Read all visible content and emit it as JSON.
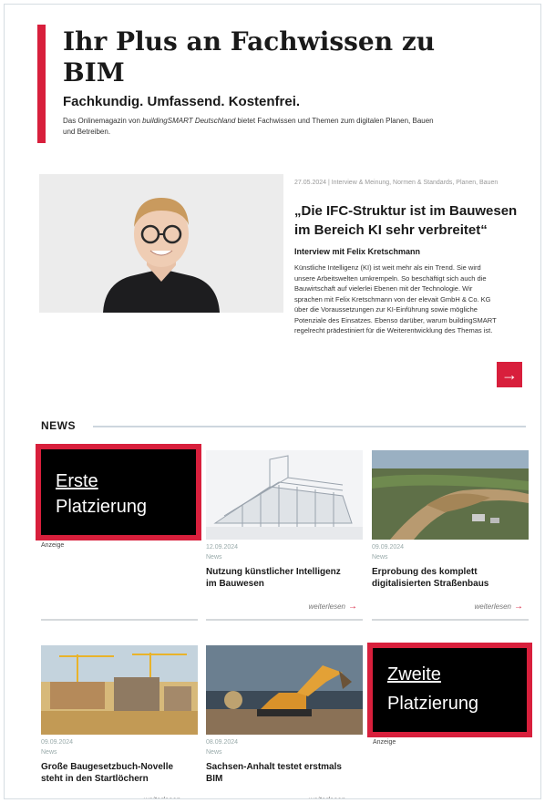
{
  "hero": {
    "title": "Ihr Plus an Fachwissen zu BIM",
    "subtitle": "Fachkundig. Umfassend. Kostenfrei.",
    "desc_before": "Das Onlinemagazin von ",
    "desc_brand": "buildingSMART Deutschland",
    "desc_after": " bietet Fachwissen und Themen zum digitalen Planen, Bauen und Betreiben."
  },
  "featured": {
    "meta": "27.05.2024 | Interview & Meinung, Normen & Standards, Planen, Bauen",
    "title": "„Die IFC-Struktur ist im Bauwesen im Bereich KI sehr verbreitet“",
    "subtitle": "Interview mit Felix Kretschmann",
    "body": "Künstliche Intelligenz (KI) ist weit mehr als ein Trend. Sie wird unsere Arbeitswelten umkrempeln. So beschäftigt sich auch die Bauwirtschaft auf vielerlei Ebenen mit der Technologie. Wir sprachen mit Felix Kretschmann von der elevait GmbH & Co. KG über die Voraussetzungen zur KI-Einführung sowie mögliche Potenziale des Einsatzes. Ebenso darüber, warum buildingSMART regelrecht prädestiniert für die Weiterentwicklung des Themas ist.",
    "arrow": "→"
  },
  "news": {
    "label": "NEWS",
    "ad1": {
      "title": "Erste",
      "sub": "Platzierung",
      "label": "Anzeige"
    },
    "ad2": {
      "title": "Zweite",
      "sub": "Platzierung",
      "label": "Anzeige"
    },
    "cards": [
      {
        "date": "12.09.2024",
        "category": "News",
        "title": "Nutzung künstlicher Intelligenz im Bauwesen",
        "more": "weiterlesen",
        "arrow": "→"
      },
      {
        "date": "09.09.2024",
        "category": "News",
        "title": "Erprobung des komplett digitalisierten Straßenbaus",
        "more": "weiterlesen",
        "arrow": "→"
      },
      {
        "date": "09.09.2024",
        "category": "News",
        "title": "Große Baugesetzbuch-Novelle steht in den Startlöchern",
        "more": "weiterlesen",
        "arrow": "→"
      },
      {
        "date": "08.09.2024",
        "category": "News",
        "title": "Sachsen-Anhalt testet erstmals BIM",
        "more": "weiterlesen",
        "arrow": "→"
      }
    ]
  },
  "colors": {
    "accent": "#d81f3c",
    "ad_bg": "#000000"
  }
}
